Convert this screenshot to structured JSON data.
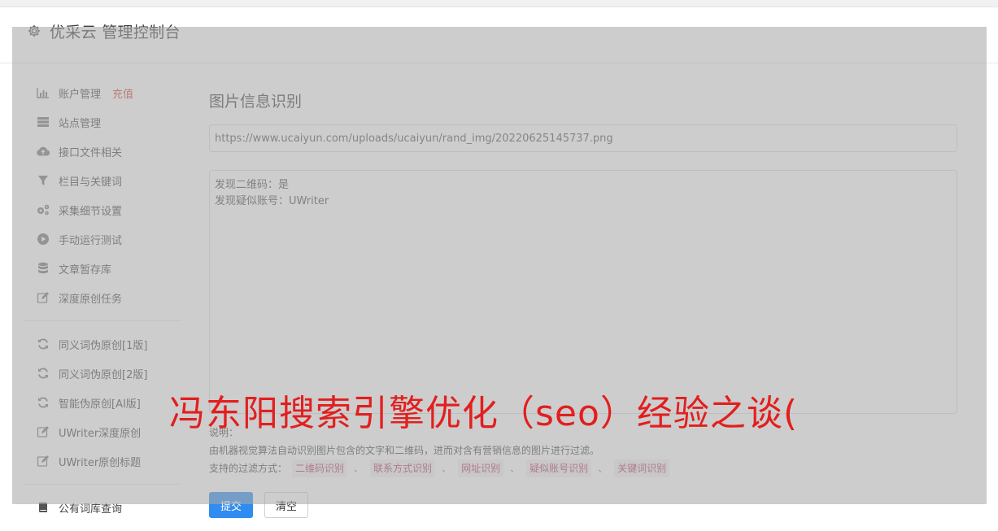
{
  "header": {
    "title": "优采云 管理控制台",
    "icon": "gear-icon"
  },
  "sidebar": {
    "items": [
      {
        "label": "账户管理",
        "badge": "充值",
        "icon": "bar-chart-icon"
      },
      {
        "label": "站点管理",
        "icon": "server-icon"
      },
      {
        "label": "接口文件相关",
        "icon": "cloud-upload-icon"
      },
      {
        "label": "栏目与关键词",
        "icon": "filter-icon"
      },
      {
        "label": "采集细节设置",
        "icon": "cogs-icon"
      },
      {
        "label": "手动运行测试",
        "icon": "play-circle-icon"
      },
      {
        "label": "文章暂存库",
        "icon": "database-icon"
      },
      {
        "label": "深度原创任务",
        "icon": "edit-icon"
      }
    ],
    "items2": [
      {
        "label": "同义词伪原创[1版]",
        "icon": "refresh-icon"
      },
      {
        "label": "同义词伪原创[2版]",
        "icon": "refresh-icon"
      },
      {
        "label": "智能伪原创[AI版]",
        "icon": "refresh-icon"
      },
      {
        "label": "UWriter深度原创",
        "icon": "edit-icon"
      },
      {
        "label": "UWriter原创标题",
        "icon": "edit-icon"
      }
    ],
    "items3": [
      {
        "label": "公有词库查询",
        "icon": "book-icon"
      }
    ]
  },
  "main": {
    "section_title": "图片信息识别",
    "url_value": "https://www.ucaiyun.com/uploads/ucaiyun/rand_img/20220625145737.png",
    "result_lines": [
      "发现二维码：是",
      "发现疑似账号：UWriter"
    ],
    "desc_title": "说明：",
    "desc_text": "由机器视觉算法自动识别图片包含的文字和二维码，进而对含有营销信息的图片进行过滤。",
    "filter_label": "支持的过滤方式：",
    "filters": [
      "二维码识别",
      "联系方式识别",
      "网址识别",
      "疑似账号识别",
      "关键词识别"
    ],
    "separator": "、",
    "submit_label": "提交",
    "clear_label": "清空"
  },
  "watermark": "冯东阳搜索引擎优化（seo）经验之谈(",
  "colors": {
    "accent": "#2f8cf0",
    "recharge": "#d33f3f",
    "tag_text": "#b23c6d",
    "watermark": "#e31e1e"
  }
}
